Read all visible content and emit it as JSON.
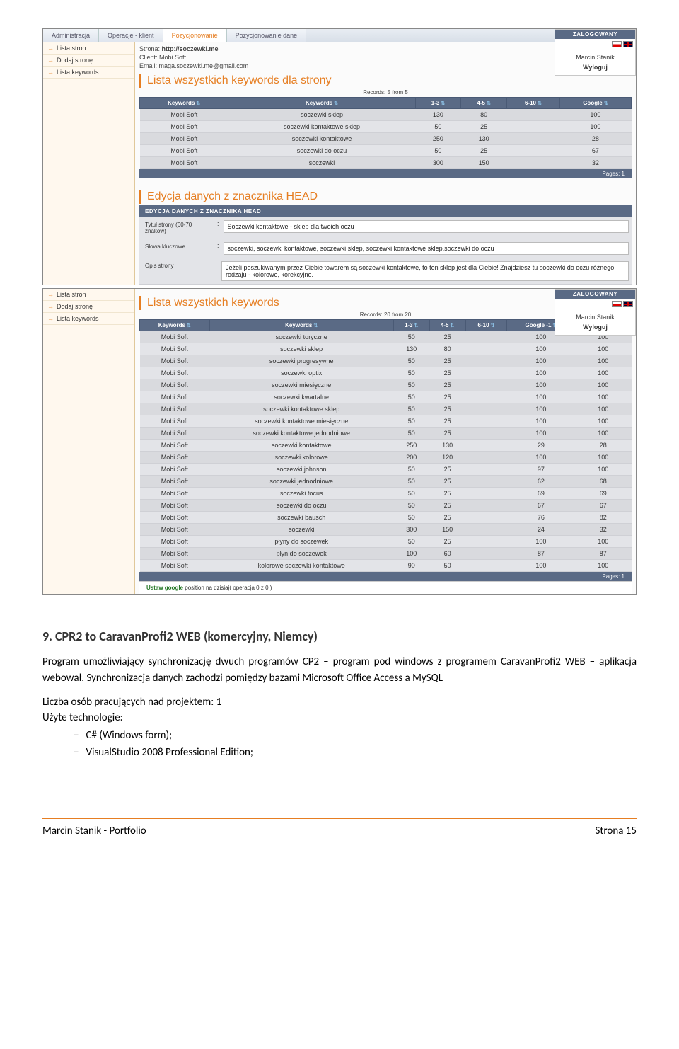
{
  "app": {
    "tabs": [
      "Administracja",
      "Operacje - klient",
      "Pozycjonowanie",
      "Pozycjonowanie dane"
    ],
    "active_tab": "Pozycjonowanie",
    "sidebar": {
      "items": [
        {
          "label": "Lista stron"
        },
        {
          "label": "Dodaj stronę"
        },
        {
          "label": "Lista keywords"
        }
      ]
    },
    "user_panel": {
      "badge": "ZALOGOWANY",
      "name": "Marcin Stanik",
      "logout": "Wyloguj"
    }
  },
  "screenshot1": {
    "info": {
      "site_label": "Strona:",
      "site_value": "http://soczewki.me",
      "client_label": "Client:",
      "client_value": "Mobi Soft",
      "email_label": "Email:",
      "email_value": "maga.soczewki.me@gmail.com"
    },
    "title": "Lista wszystkich keywords dla strony",
    "records": "Records: 5 from 5",
    "columns": [
      "Keywords",
      "Keywords",
      "1-3",
      "4-5",
      "6-10",
      "Google"
    ],
    "rows": [
      [
        "Mobi Soft",
        "soczewki sklep",
        "130",
        "80",
        "",
        "100"
      ],
      [
        "Mobi Soft",
        "soczewki kontaktowe sklep",
        "50",
        "25",
        "",
        "100"
      ],
      [
        "Mobi Soft",
        "soczewki kontaktowe",
        "250",
        "130",
        "",
        "28"
      ],
      [
        "Mobi Soft",
        "soczewki do oczu",
        "50",
        "25",
        "",
        "67"
      ],
      [
        "Mobi Soft",
        "soczewki",
        "300",
        "150",
        "",
        "32"
      ]
    ],
    "pages": "Pages:  1",
    "head_title": "Edycja danych z znacznika HEAD",
    "head_header": "EDYCJA DANYCH Z ZNACZNIKA HEAD",
    "form": {
      "f1_label": "Tytuł strony (60-70 znaków)",
      "f1_value": "Soczewki kontaktowe - sklep dla twoich oczu",
      "f2_label": "Słowa kluczowe",
      "f2_value": "soczewki, soczewki kontaktowe, soczewki sklep, soczewki kontaktowe sklep,soczewki do oczu",
      "f3_label": "Opis strony",
      "f3_value": "Jeżeli poszukiwanym przez Ciebie towarem są soczewki kontaktowe, to ten sklep jest dla Ciebie! Znajdziesz tu soczewki do oczu różnego rodzaju - kolorowe, korekcyjne."
    }
  },
  "screenshot2": {
    "title": "Lista wszystkich keywords",
    "records": "Records: 20 from 20",
    "columns": [
      "Keywords",
      "Keywords",
      "1-3",
      "4-5",
      "6-10",
      "Google -1",
      "Google"
    ],
    "rows": [
      [
        "Mobi Soft",
        "soczewki toryczne",
        "50",
        "25",
        "",
        "100",
        "100"
      ],
      [
        "Mobi Soft",
        "soczewki sklep",
        "130",
        "80",
        "",
        "100",
        "100"
      ],
      [
        "Mobi Soft",
        "soczewki progresywne",
        "50",
        "25",
        "",
        "100",
        "100"
      ],
      [
        "Mobi Soft",
        "soczewki optix",
        "50",
        "25",
        "",
        "100",
        "100"
      ],
      [
        "Mobi Soft",
        "soczewki miesięczne",
        "50",
        "25",
        "",
        "100",
        "100"
      ],
      [
        "Mobi Soft",
        "soczewki kwartalne",
        "50",
        "25",
        "",
        "100",
        "100"
      ],
      [
        "Mobi Soft",
        "soczewki kontaktowe sklep",
        "50",
        "25",
        "",
        "100",
        "100"
      ],
      [
        "Mobi Soft",
        "soczewki kontaktowe miesięczne",
        "50",
        "25",
        "",
        "100",
        "100"
      ],
      [
        "Mobi Soft",
        "soczewki kontaktowe jednodniowe",
        "50",
        "25",
        "",
        "100",
        "100"
      ],
      [
        "Mobi Soft",
        "soczewki kontaktowe",
        "250",
        "130",
        "",
        "29",
        "28"
      ],
      [
        "Mobi Soft",
        "soczewki kolorowe",
        "200",
        "120",
        "",
        "100",
        "100"
      ],
      [
        "Mobi Soft",
        "soczewki johnson",
        "50",
        "25",
        "",
        "97",
        "100"
      ],
      [
        "Mobi Soft",
        "soczewki jednodniowe",
        "50",
        "25",
        "",
        "62",
        "68"
      ],
      [
        "Mobi Soft",
        "soczewki focus",
        "50",
        "25",
        "",
        "69",
        "69"
      ],
      [
        "Mobi Soft",
        "soczewki do oczu",
        "50",
        "25",
        "",
        "67",
        "67"
      ],
      [
        "Mobi Soft",
        "soczewki bausch",
        "50",
        "25",
        "",
        "76",
        "82"
      ],
      [
        "Mobi Soft",
        "soczewki",
        "300",
        "150",
        "",
        "24",
        "32"
      ],
      [
        "Mobi Soft",
        "płyny do soczewek",
        "50",
        "25",
        "",
        "100",
        "100"
      ],
      [
        "Mobi Soft",
        "płyn do soczewek",
        "100",
        "60",
        "",
        "87",
        "87"
      ],
      [
        "Mobi Soft",
        "kolorowe soczewki kontaktowe",
        "90",
        "50",
        "",
        "100",
        "100"
      ]
    ],
    "pages": "Pages:  1",
    "status_prefix": "Ustaw google",
    "status_rest": " position na dzisiaj( operacja 0 z 0 )"
  },
  "document": {
    "heading": "9. CPR2 to CaravanProfi2 WEB (komercyjny, Niemcy)",
    "para": "Program umożliwiający synchronizację dwuch programów CP2 – program pod windows z programem CaravanProfi2 WEB – aplikacja webował. Synchronizacja danych zachodzi pomiędzy bazami  Microsoft Office Access a MySQL",
    "people_line": "Liczba osób pracujących nad projektem: 1",
    "tech_line": "Użyte technologie:",
    "bullets": [
      "C# (Windows form);",
      "VisualStudio 2008 Professional Edition;"
    ]
  },
  "footer": {
    "left": "Marcin Stanik - Portfolio",
    "right": "Strona 15"
  }
}
